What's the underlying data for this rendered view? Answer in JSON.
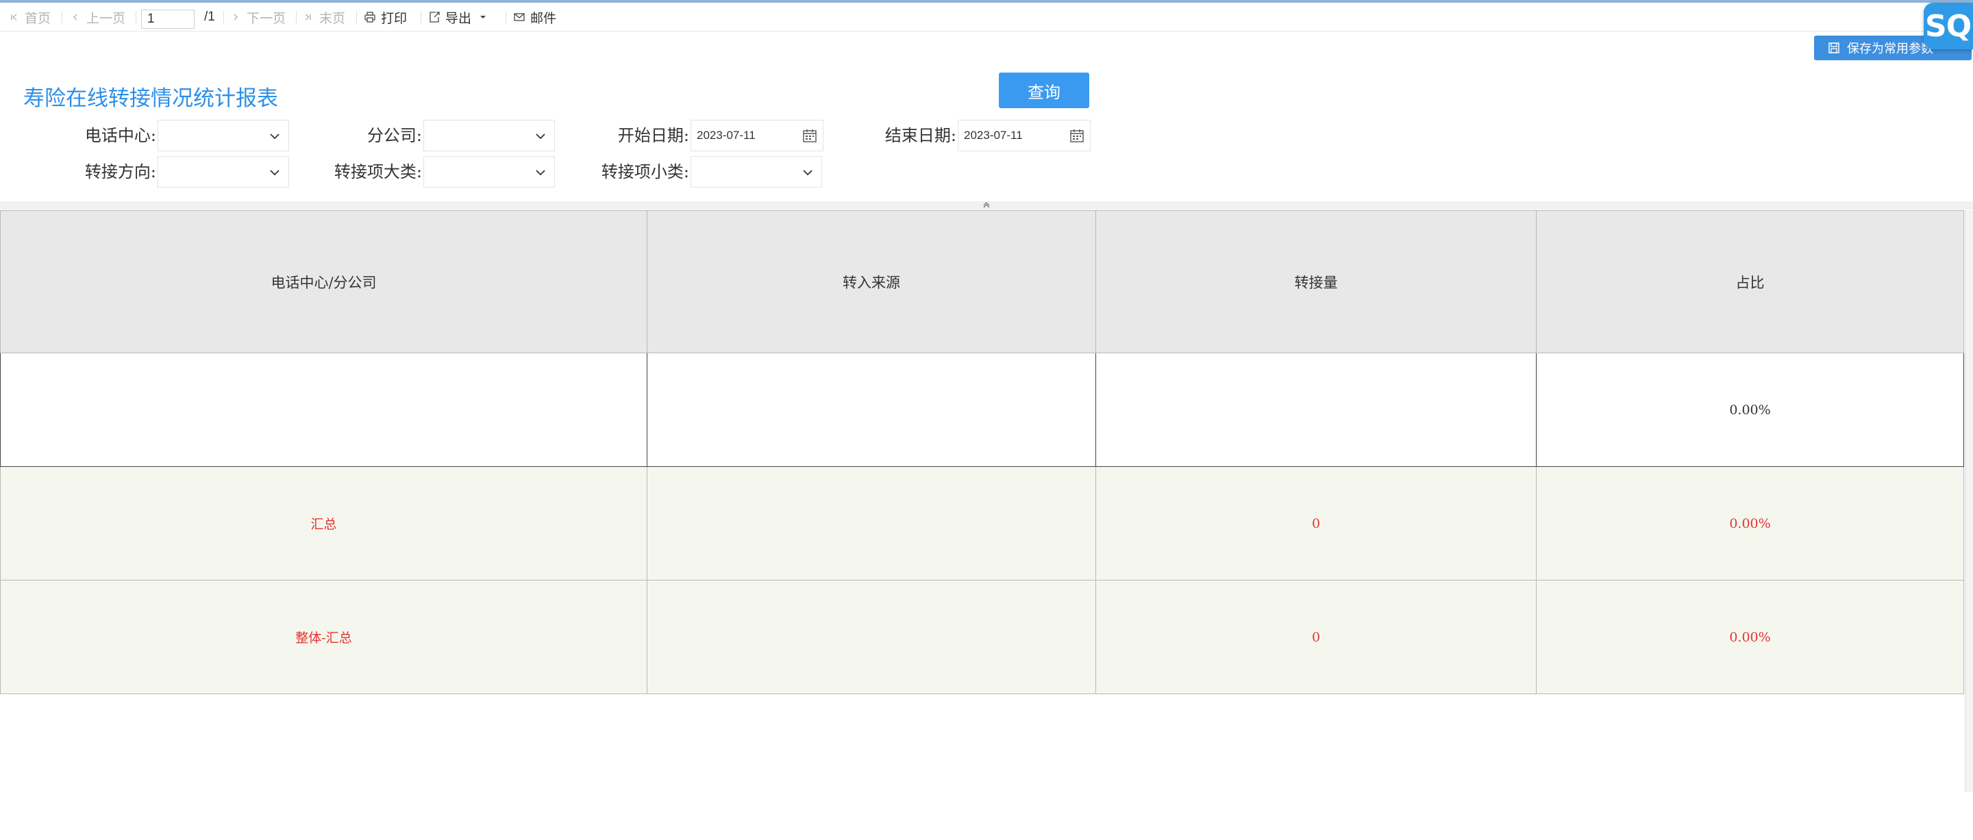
{
  "toolbar": {
    "first": "首页",
    "prev": "上一页",
    "page_value": "1",
    "page_total": "/1",
    "next": "下一页",
    "last": "末页",
    "print": "打印",
    "export": "导出",
    "mail": "邮件"
  },
  "top_right": {
    "save_params": "保存为常用参数",
    "sql_badge": "SQL"
  },
  "report_title": "寿险在线转接情况统计报表",
  "query_button": "查询",
  "filters": {
    "call_center": {
      "label": "电话中心:",
      "value": ""
    },
    "branch": {
      "label": "分公司:",
      "value": ""
    },
    "start_date": {
      "label": "开始日期:",
      "value": "2023-07-11"
    },
    "end_date": {
      "label": "结束日期:",
      "value": "2023-07-11"
    },
    "direction": {
      "label": "转接方向:",
      "value": ""
    },
    "category": {
      "label": "转接项大类:",
      "value": ""
    },
    "subcategory": {
      "label": "转接项小类:",
      "value": ""
    }
  },
  "table": {
    "headers": [
      "电话中心/分公司",
      "转入来源",
      "转接量",
      "占比"
    ],
    "rows": [
      {
        "type": "data",
        "cells": [
          "",
          "",
          "",
          "0.00%"
        ]
      },
      {
        "type": "sum",
        "cells": [
          "汇总",
          "",
          "0",
          "0.00%"
        ]
      },
      {
        "type": "sum",
        "cells": [
          "整体-汇总",
          "",
          "0",
          "0.00%"
        ]
      }
    ]
  },
  "colors": {
    "accent": "#2c8fe8",
    "button": "#3a9af0",
    "summary_text": "#e8322f",
    "summary_bg": "#f5f7ee",
    "header_bg": "#e8e8e8"
  }
}
